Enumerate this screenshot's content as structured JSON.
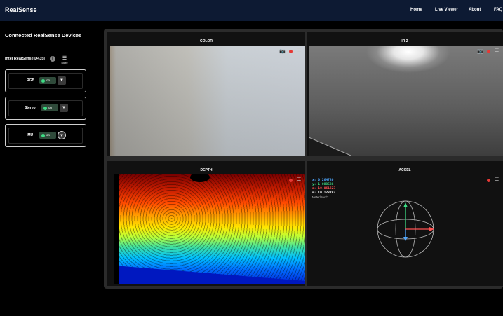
{
  "header": {
    "brand": "RealSense",
    "nav": [
      "Home",
      "Live Viewer",
      "About",
      "FAQ"
    ]
  },
  "sidebar": {
    "title": "Connected RealSense Devices",
    "device_name": "Intel RealSense D435i",
    "info_icon": "i",
    "more_label": "More",
    "streams": [
      {
        "label": "RGB",
        "toggle": "on"
      },
      {
        "label": "Stereo",
        "toggle": "on"
      },
      {
        "label": "IMU",
        "toggle": "on"
      }
    ]
  },
  "viewer": {
    "btn_3d": "3D",
    "panels": {
      "color": "COLOR",
      "ir2": "IR 2",
      "depth": "DEPTH",
      "accel": "ACCEL"
    },
    "accel": {
      "x": "x: 0.264780",
      "y": "y: 1.088538",
      "z": "z: 10.061623",
      "m": "m: 10.123797",
      "unit": "Meter/Sec^2"
    }
  },
  "colors": {
    "header_bg": "#0d1a33",
    "toggle_on": "#3ddc84",
    "record": "#e53935",
    "accel_x": "#4fa8ff",
    "accel_y": "#3ddc84",
    "accel_z": "#ff5252"
  }
}
